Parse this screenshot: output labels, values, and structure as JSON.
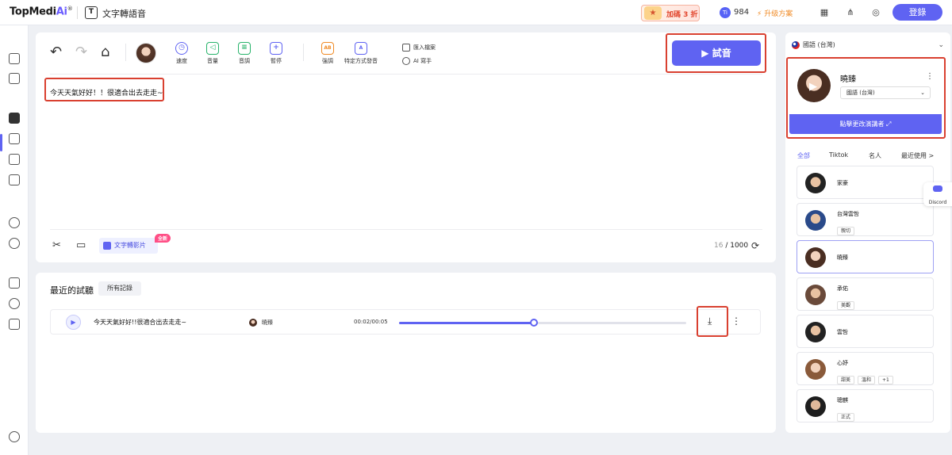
{
  "topbar": {
    "logo_main": "TopMedi",
    "logo_ai": "Ai",
    "logo_reg": "®",
    "app_title": "文字轉語音",
    "promo_label": "加碼 3 折",
    "credits": "984",
    "upgrade_label": "升级方案",
    "login_label": "登錄"
  },
  "toolbar": {
    "tools": [
      {
        "label": "速度",
        "color": "#5f63f2"
      },
      {
        "label": "音量",
        "color": "#27b36a"
      },
      {
        "label": "音調",
        "color": "#27b36a"
      },
      {
        "label": "暫停",
        "color": "#5f63f2"
      },
      {
        "label": "強調",
        "color": "#f08a24"
      },
      {
        "label": "特定方式發音",
        "color": "#5f63f2"
      }
    ],
    "import_file": "匯入檔案",
    "ai_helper": "AI 寫手",
    "preview_label": "試音"
  },
  "editor": {
    "text": "今天天氣好好！！很適合出去走走~",
    "to_video_label": "文字轉影片",
    "new_badge": "全新",
    "char_count": "16",
    "char_limit": "1000"
  },
  "history": {
    "title": "最近的試聽",
    "all_records": "所有記錄",
    "items": [
      {
        "text": "今天天氣好好!!很適合出去走走~",
        "voice": "曉臻",
        "time": "00:02/00:05",
        "progress": 0.47
      }
    ]
  },
  "right_panel": {
    "language": "國語 (台灣)",
    "current_voice": {
      "name": "曉臻",
      "language": "國語 (台灣)"
    },
    "change_voice_label": "點擊更改演講者",
    "tabs": [
      "全部",
      "Tiktok",
      "名人",
      "最近使用 >"
    ],
    "voices": [
      {
        "name": "家豪",
        "tags": []
      },
      {
        "name": "台灣雲哲",
        "tags": [
          "親切"
        ]
      },
      {
        "name": "曉臻",
        "tags": []
      },
      {
        "name": "承佑",
        "tags": [
          "美觀"
        ]
      },
      {
        "name": "雲哲",
        "tags": []
      },
      {
        "name": "心妤",
        "tags": [
          "甜美",
          "溫和",
          "+1"
        ]
      },
      {
        "name": "聰麒",
        "tags": [
          "正式"
        ]
      }
    ]
  },
  "discord_label": "Discord",
  "colors": {
    "accent": "#5f63f2",
    "highlight": "#d94030"
  }
}
